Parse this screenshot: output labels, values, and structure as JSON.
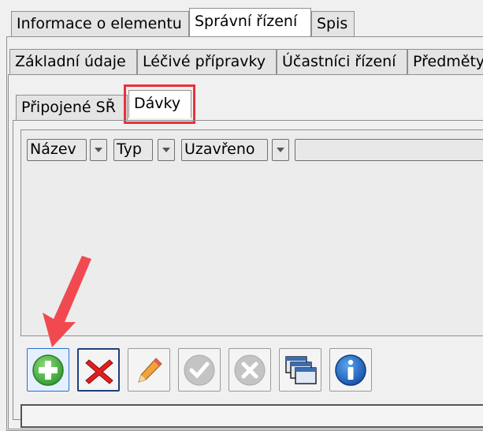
{
  "tabs_level1": [
    "Informace o elementu",
    "Správní řízení",
    "Spis"
  ],
  "tabs_level2": [
    "Základní údaje",
    "Léčivé přípravky",
    "Účastníci řízení",
    "Předměty"
  ],
  "tabs_level3": [
    "Připojené SŘ",
    "Dávky"
  ],
  "grid": {
    "columns": [
      "Název",
      "Typ",
      "Uzavřeno"
    ]
  },
  "toolbar": [
    {
      "name": "add",
      "icon": "plus-circle-icon",
      "enabled": true
    },
    {
      "name": "delete",
      "icon": "red-x-icon",
      "enabled": true
    },
    {
      "name": "edit",
      "icon": "pencil-icon",
      "enabled": true
    },
    {
      "name": "confirm",
      "icon": "check-circle-icon",
      "enabled": false
    },
    {
      "name": "cancel",
      "icon": "x-circle-icon",
      "enabled": false
    },
    {
      "name": "windows",
      "icon": "windows-icon",
      "enabled": true
    },
    {
      "name": "info",
      "icon": "info-icon",
      "enabled": true
    }
  ],
  "colors": {
    "highlight": "#e8323c",
    "arrow": "#f04a50"
  }
}
